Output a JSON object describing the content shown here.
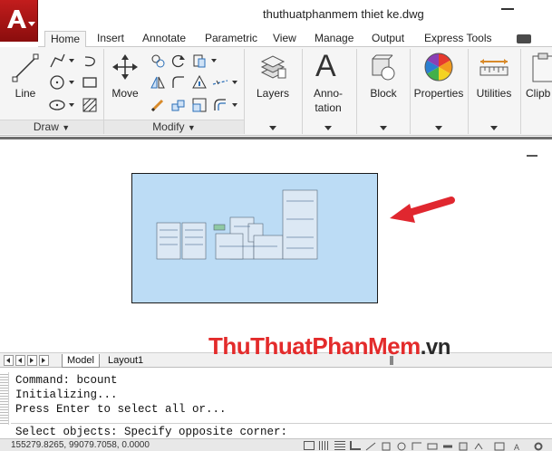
{
  "window": {
    "title": "thuthuatphanmem thiet ke.dwg"
  },
  "ribbon_tabs": [
    {
      "label": "Home",
      "active": true
    },
    {
      "label": "Insert"
    },
    {
      "label": "Annotate"
    },
    {
      "label": "Parametric"
    },
    {
      "label": "View"
    },
    {
      "label": "Manage"
    },
    {
      "label": "Output"
    },
    {
      "label": "Express Tools"
    }
  ],
  "ribbon": {
    "draw": {
      "title": "Draw",
      "line_label": "Line"
    },
    "modify": {
      "title": "Modify",
      "move_label": "Move"
    },
    "layers_label": "Layers",
    "annotation_label_1": "Anno-",
    "annotation_label_2": "tation",
    "block_label": "Block",
    "properties_label": "Properties",
    "utilities_label": "Utilities",
    "clipboard_label": "Clipb"
  },
  "layout_tabs": [
    {
      "label": "Model",
      "active": true
    },
    {
      "label": "Layout1"
    }
  ],
  "command_history": [
    "Command: bcount",
    "Initializing...",
    "Press Enter to select all or..."
  ],
  "command_prompt": "Select objects: Specify opposite corner:",
  "status": {
    "coordinates": "155279.8265, 99079.7058, 0.0000"
  },
  "watermark": {
    "part1": "ThuThuat",
    "part2": "PhanMem",
    "part3": ".vn"
  },
  "colors": {
    "app_red": "#b01515",
    "viewport_fill": "#bcdcf5",
    "arrow_red": "#e0272f"
  }
}
